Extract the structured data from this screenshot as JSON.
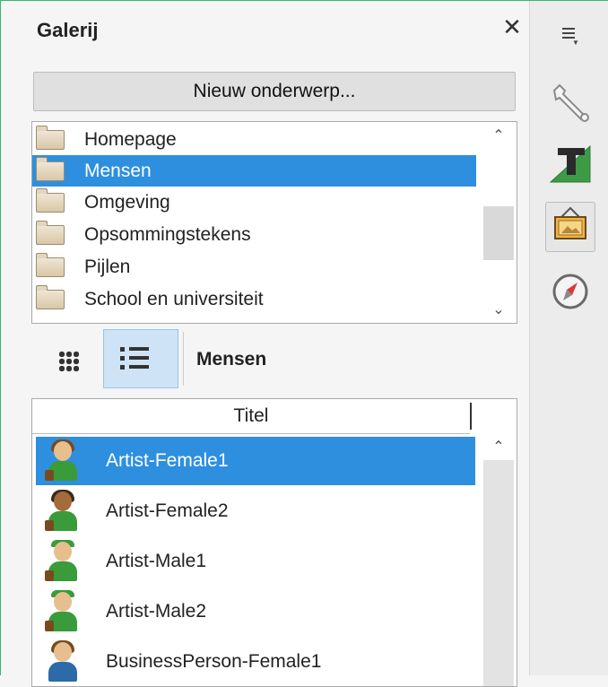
{
  "panel": {
    "title": "Galerij",
    "close_label": "✕",
    "new_topic_label": "Nieuw onderwerp..."
  },
  "topics": [
    {
      "label": "Homepage",
      "selected": false
    },
    {
      "label": "Mensen",
      "selected": true
    },
    {
      "label": "Omgeving",
      "selected": false
    },
    {
      "label": "Opsommingstekens",
      "selected": false
    },
    {
      "label": "Pijlen",
      "selected": false
    },
    {
      "label": "School en universiteit",
      "selected": false
    }
  ],
  "view": {
    "current_topic": "Mensen",
    "icon_view_icon": "grid-icon",
    "list_view_icon": "list-icon",
    "active_view": "list"
  },
  "items_list": {
    "column_title": "Titel",
    "items": [
      {
        "label": "Artist-Female1",
        "selected": true,
        "hair": "#7a4a1f",
        "body": "#3a9b3a"
      },
      {
        "label": "Artist-Female2",
        "selected": false,
        "hair": "#3b2a1a",
        "body": "#3a9b3a"
      },
      {
        "label": "Artist-Male1",
        "selected": false,
        "hair": "#3a9b3a",
        "body": "#3a9b3a"
      },
      {
        "label": "Artist-Male2",
        "selected": false,
        "hair": "#3a9b3a",
        "body": "#3a9b3a"
      },
      {
        "label": "BusinessPerson-Female1",
        "selected": false,
        "hair": "#7a4a1f",
        "body": "#2d6aa8"
      }
    ]
  },
  "sidebar": {
    "menu_icon": "menu-icon",
    "buttons": [
      {
        "name": "properties-icon",
        "active": false
      },
      {
        "name": "styles-icon",
        "active": false
      },
      {
        "name": "gallery-icon",
        "active": true
      },
      {
        "name": "navigator-icon",
        "active": false
      }
    ]
  },
  "colors": {
    "selection": "#2e8fdf",
    "frame": "#3cb371"
  }
}
